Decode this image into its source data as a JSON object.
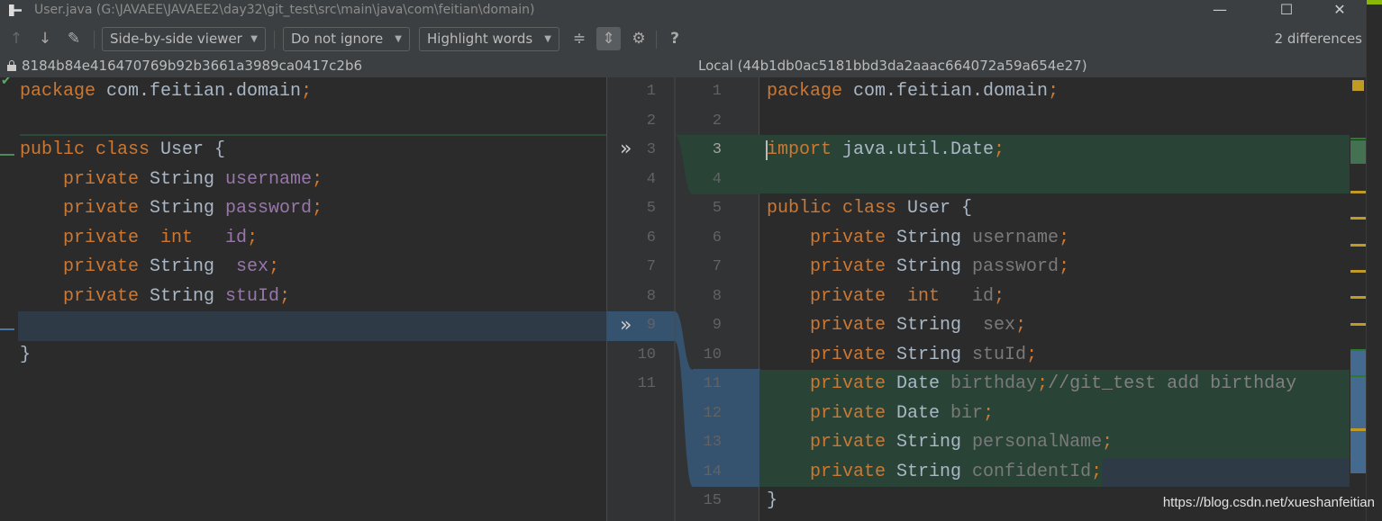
{
  "window": {
    "title": "User.java (G:\\JAVAEE\\JAVAEE2\\day32\\git_test\\src\\main\\java\\com\\feitian\\domain)",
    "minimize": "—",
    "maximize": "☐",
    "close": "✕"
  },
  "toolbar": {
    "prev_icon": "arrow-up-icon",
    "next_icon": "arrow-down-icon",
    "edit_icon": "pencil-icon",
    "viewer": "Side-by-side viewer",
    "ignore": "Do not ignore",
    "highlight": "Highlight words",
    "collapse_icon": "collapse-unchanged-icon",
    "sync_icon": "sync-scroll-icon",
    "settings_icon": "gear-icon",
    "help": "?",
    "differences": "2 differences"
  },
  "left": {
    "revision": "8184b84e416470769b92b3661a3989ca0417c2b6",
    "lines": [
      [
        [
          "package",
          "kw"
        ],
        [
          " com.feitian.domain",
          "tx"
        ],
        [
          ";",
          "kw"
        ]
      ],
      [],
      [
        [
          "public class ",
          "kw"
        ],
        [
          "User {",
          "tx"
        ]
      ],
      [
        [
          "    private ",
          "kw"
        ],
        [
          "String ",
          "tx"
        ],
        [
          "username",
          "fd"
        ],
        [
          ";",
          "kw"
        ]
      ],
      [
        [
          "    private ",
          "kw"
        ],
        [
          "String ",
          "tx"
        ],
        [
          "password",
          "fd"
        ],
        [
          ";",
          "kw"
        ]
      ],
      [
        [
          "    private  int   ",
          "kw"
        ],
        [
          "id",
          "fd"
        ],
        [
          ";",
          "kw"
        ]
      ],
      [
        [
          "    private ",
          "kw"
        ],
        [
          "String  ",
          "tx"
        ],
        [
          "sex",
          "fd"
        ],
        [
          ";",
          "kw"
        ]
      ],
      [
        [
          "    private ",
          "kw"
        ],
        [
          "String ",
          "tx"
        ],
        [
          "stuId",
          "fd"
        ],
        [
          ";",
          "kw"
        ]
      ],
      [],
      [
        [
          "}",
          "tx"
        ]
      ],
      []
    ]
  },
  "right": {
    "revision": "Local (44b1db0ac5181bbd3da2aaac664072a59a654e27)",
    "lines": [
      [
        [
          "package",
          "kw"
        ],
        [
          " com.feitian.domain",
          "tx"
        ],
        [
          ";",
          "kw"
        ]
      ],
      [],
      [
        [
          "import ",
          "kw"
        ],
        [
          "java.util.Date",
          "tx"
        ],
        [
          ";",
          "kw"
        ]
      ],
      [],
      [
        [
          "public class ",
          "kw"
        ],
        [
          "User {",
          "tx"
        ]
      ],
      [
        [
          "    private ",
          "kw"
        ],
        [
          "String ",
          "tx"
        ],
        [
          "username",
          "un"
        ],
        [
          ";",
          "kw"
        ]
      ],
      [
        [
          "    private ",
          "kw"
        ],
        [
          "String ",
          "tx"
        ],
        [
          "password",
          "un"
        ],
        [
          ";",
          "kw"
        ]
      ],
      [
        [
          "    private  int   ",
          "kw"
        ],
        [
          "id",
          "un"
        ],
        [
          ";",
          "kw"
        ]
      ],
      [
        [
          "    private ",
          "kw"
        ],
        [
          "String  ",
          "tx"
        ],
        [
          "sex",
          "un"
        ],
        [
          ";",
          "kw"
        ]
      ],
      [
        [
          "    private ",
          "kw"
        ],
        [
          "String ",
          "tx"
        ],
        [
          "stuId",
          "un"
        ],
        [
          ";",
          "kw"
        ]
      ],
      [
        [
          "    private ",
          "kw"
        ],
        [
          "Date ",
          "tx"
        ],
        [
          "birthday",
          "un"
        ],
        [
          ";",
          "kw"
        ],
        [
          "//git_test add birthday",
          "cm"
        ]
      ],
      [
        [
          "    private ",
          "kw"
        ],
        [
          "Date ",
          "tx"
        ],
        [
          "bir",
          "un"
        ],
        [
          ";",
          "kw"
        ]
      ],
      [
        [
          "    private ",
          "kw"
        ],
        [
          "String ",
          "tx"
        ],
        [
          "personalName",
          "un"
        ],
        [
          ";",
          "kw"
        ]
      ],
      [
        [
          "    private ",
          "kw"
        ],
        [
          "String ",
          "tx"
        ],
        [
          "confidentId",
          "un"
        ],
        [
          ";",
          "kw"
        ]
      ],
      [
        [
          "}",
          "tx"
        ]
      ]
    ]
  },
  "colors": {
    "inserted": "#294436",
    "changed": "#2f3a47",
    "changed_gutter": "#35536f",
    "keyword": "#cc7832",
    "field": "#9876aa",
    "marker": "#c09a22"
  },
  "watermark": "https://blog.csdn.net/xueshanfeitian"
}
